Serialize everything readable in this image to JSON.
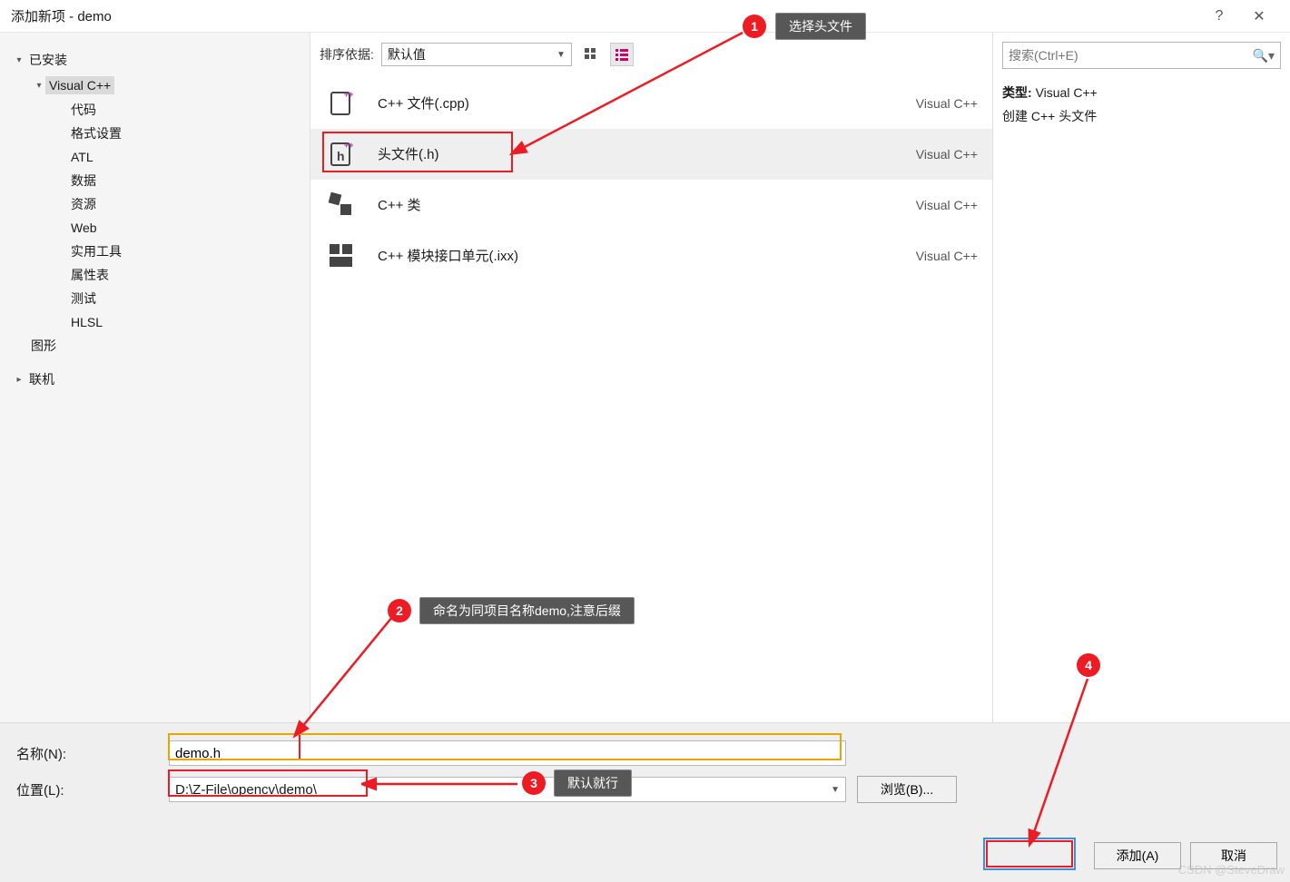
{
  "window": {
    "title": "添加新项 - demo",
    "help": "?",
    "close": "✕"
  },
  "tree": {
    "installed": "已安装",
    "vcpp": "Visual C++",
    "leaves": [
      "代码",
      "格式设置",
      "ATL",
      "数据",
      "资源",
      "Web",
      "实用工具",
      "属性表",
      "测试",
      "HLSL"
    ],
    "graphics": "图形",
    "online": "联机"
  },
  "toolbar": {
    "sort_label": "排序依据:",
    "sort_value": "默认值"
  },
  "templates": [
    {
      "label": "C++ 文件(.cpp)",
      "lang": "Visual C++"
    },
    {
      "label": "头文件(.h)",
      "lang": "Visual C++"
    },
    {
      "label": "C++ 类",
      "lang": "Visual C++"
    },
    {
      "label": "C++ 模块接口单元(.ixx)",
      "lang": "Visual C++"
    }
  ],
  "rightpane": {
    "search_placeholder": "搜索(Ctrl+E)",
    "type_label": "类型:",
    "type_value": "Visual C++",
    "desc": "创建 C++ 头文件"
  },
  "bottom": {
    "name_label": "名称(N):",
    "name_value": "demo.h",
    "loc_label": "位置(L):",
    "loc_value": "D:\\Z-File\\opencv\\demo\\",
    "browse": "浏览(B)...",
    "add": "添加(A)",
    "cancel": "取消"
  },
  "anno": {
    "c1": "1",
    "c1_label": "选择头文件",
    "c2": "2",
    "c2_label": "命名为同项目名称demo,注意后缀",
    "c3": "3",
    "c3_label": "默认就行",
    "c4": "4"
  },
  "watermark": "CSDN @SteveDraw"
}
